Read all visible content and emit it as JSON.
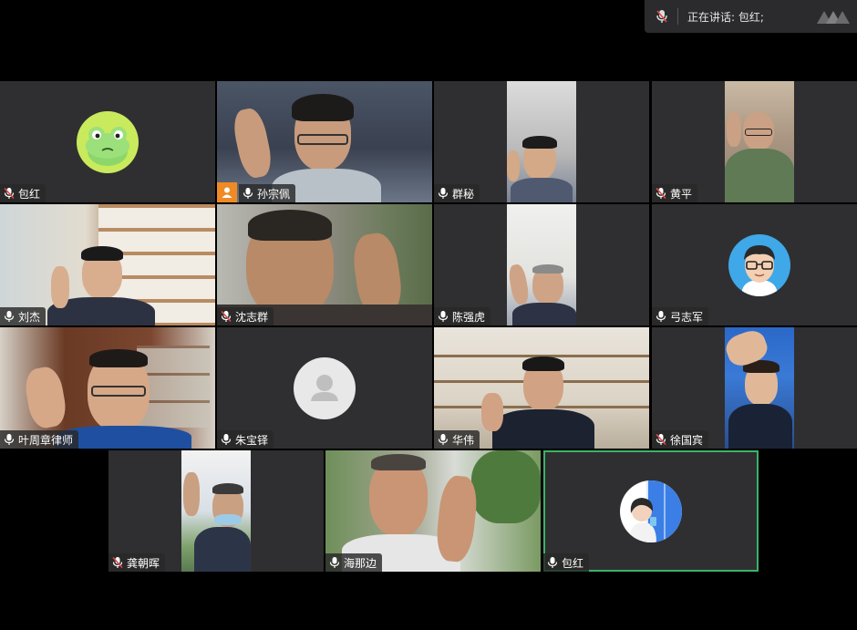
{
  "speaking_bar": {
    "prefix": "正在讲话: ",
    "name": "包红;"
  },
  "colors": {
    "active_border": "#3ab36a",
    "tile_bg": "#2f2f31",
    "host_badge": "#f08a24",
    "muted_red": "#e04848"
  },
  "participants": [
    {
      "name": "包红",
      "mic": "muted",
      "video": "off-avatar",
      "avatar": "frog-avatar"
    },
    {
      "name": "孙宗佩",
      "mic": "on",
      "video": "on",
      "host": true
    },
    {
      "name": "群秘",
      "mic": "on",
      "video": "on"
    },
    {
      "name": "黄平",
      "mic": "muted",
      "video": "on"
    },
    {
      "name": "刘杰",
      "mic": "on",
      "video": "on"
    },
    {
      "name": "沈志群",
      "mic": "muted",
      "video": "on"
    },
    {
      "name": "陈强虎",
      "mic": "on",
      "video": "on"
    },
    {
      "name": "弓志军",
      "mic": "on",
      "video": "off-avatar",
      "avatar": "cartoon-man-avatar"
    },
    {
      "name": "叶周章律师",
      "mic": "on",
      "video": "on"
    },
    {
      "name": "朱宝铎",
      "mic": "on",
      "video": "off-avatar",
      "avatar": "default-user-avatar"
    },
    {
      "name": "华伟",
      "mic": "on",
      "video": "on"
    },
    {
      "name": "徐国宾",
      "mic": "muted",
      "video": "on"
    },
    {
      "name": "龚朝晖",
      "mic": "muted",
      "video": "on"
    },
    {
      "name": "海那边",
      "mic": "on",
      "video": "on"
    },
    {
      "name": "包红",
      "mic": "on",
      "video": "off-avatar",
      "avatar": "girl-window-avatar",
      "active": true
    }
  ]
}
